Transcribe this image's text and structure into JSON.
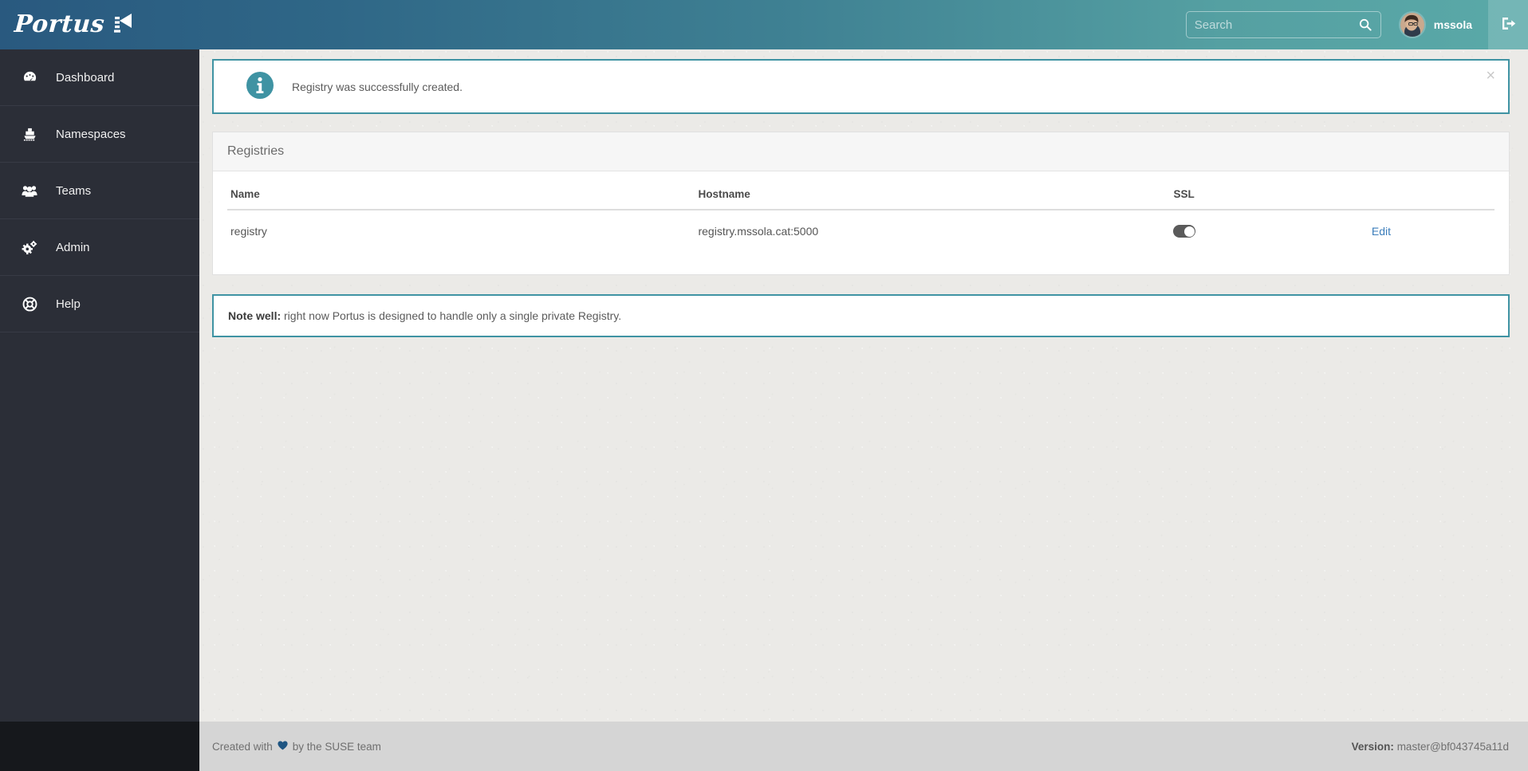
{
  "header": {
    "brand_name": "Portus",
    "brand_icon": "lighthouse-icon",
    "search": {
      "placeholder": "Search",
      "value": "",
      "icon": "search-icon"
    },
    "user": {
      "name": "mssola",
      "avatar_alt": "mssola-avatar"
    },
    "logout": {
      "label": "",
      "icon": "sign-out-icon"
    },
    "gradient_from": "#29597f",
    "gradient_to": "#5aa9a8"
  },
  "sidebar": {
    "items": [
      {
        "label": "Dashboard",
        "icon": "dashboard-icon"
      },
      {
        "label": "Namespaces",
        "icon": "ship-icon"
      },
      {
        "label": "Teams",
        "icon": "users-icon"
      },
      {
        "label": "Admin",
        "icon": "cogs-icon"
      },
      {
        "label": "Help",
        "icon": "life-ring-icon"
      }
    ],
    "background": "#2b2e37"
  },
  "alert": {
    "icon": "info-circle-icon",
    "message": "Registry was successfully created.",
    "close_label": "×",
    "border_color": "#3f93a3"
  },
  "panel": {
    "title": "Registries",
    "table": {
      "columns": [
        "Name",
        "Hostname",
        "SSL",
        ""
      ],
      "rows": [
        {
          "name": "registry",
          "hostname": "registry.mssola.cat:5000",
          "ssl_enabled": false,
          "ssl_icon": "toggle-switch",
          "action_label": "Edit"
        }
      ]
    }
  },
  "note": {
    "strong": "Note well:",
    "text": " right now Portus is designed to handle only a single private Registry.",
    "border_color": "#3f93a3"
  },
  "footer": {
    "created_prefix": "Created with",
    "heart_icon": "heart-icon",
    "created_suffix": "by the SUSE team",
    "version_label": "Version:",
    "version_value": "master@bf043745a11d"
  }
}
